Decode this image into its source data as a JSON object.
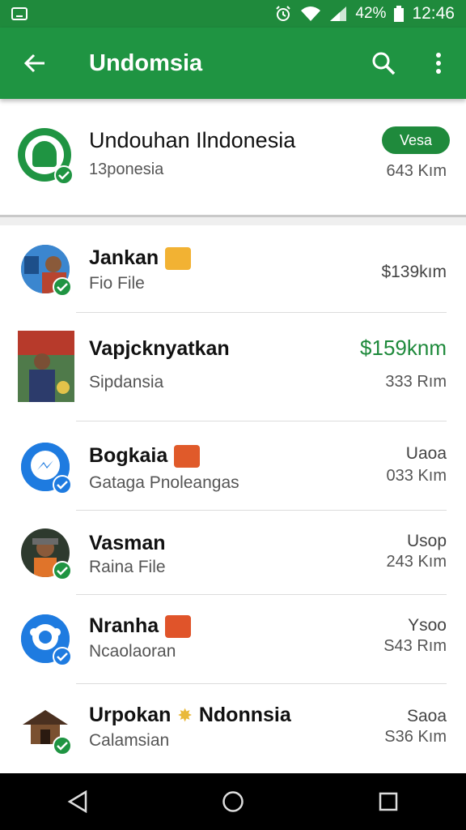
{
  "status_bar": {
    "battery": "42%",
    "time": "12:46",
    "icons": [
      "notification-icon",
      "alarm-icon",
      "wifi-icon",
      "signal-icon",
      "battery-icon"
    ]
  },
  "app_bar": {
    "title": "Undomsia",
    "icons": [
      "back-arrow-icon",
      "search-icon",
      "more-vert-icon"
    ]
  },
  "header": {
    "name": "Undouhan Ilndonesia",
    "subtitle": "13ponesia",
    "button": "Vesa",
    "distance": "643 Kım"
  },
  "items": [
    {
      "title": "Jankan",
      "subtitle": "Fio File",
      "right_top": "$139kım",
      "right_bottom": "",
      "tag_color": "#f2b233",
      "avatar": "person"
    },
    {
      "title": "Vapjcknyatkan",
      "subtitle": "Sipdansia",
      "right_top": "$159knm",
      "right_bottom": "333 Rım",
      "tag_color": "",
      "avatar": "photo"
    },
    {
      "title": "Bogkaia",
      "subtitle": "Gatagа Pnoleangas",
      "right_top": "Uaoa",
      "right_bottom": "033 Kım",
      "tag_color": "#e05a2a",
      "avatar": "messenger"
    },
    {
      "title": "Vasman",
      "subtitle": "Raina File",
      "right_top": "Usop",
      "right_bottom": "243 Kım",
      "tag_color": "",
      "avatar": "person-dark"
    },
    {
      "title": "Nranha",
      "subtitle": "Ncaolaoran",
      "right_top": "Ysoo",
      "right_bottom": "S43 Rım",
      "tag_color": "#e0542a",
      "avatar": "chat"
    },
    {
      "title": "Urpokan",
      "title_suffix": "Ndonnsia",
      "subtitle": "Calamsian",
      "right_top": "Saoa",
      "right_bottom": "S36 Kım",
      "tag_color": "#e9b93a",
      "avatar": "house"
    }
  ],
  "colors": {
    "primary": "#1f9442",
    "status_bar": "#1f8a3c",
    "price_green": "#1f8a3c"
  },
  "nav_bar": {
    "icons": [
      "back-triangle-icon",
      "home-circle-icon",
      "recents-square-icon"
    ]
  }
}
